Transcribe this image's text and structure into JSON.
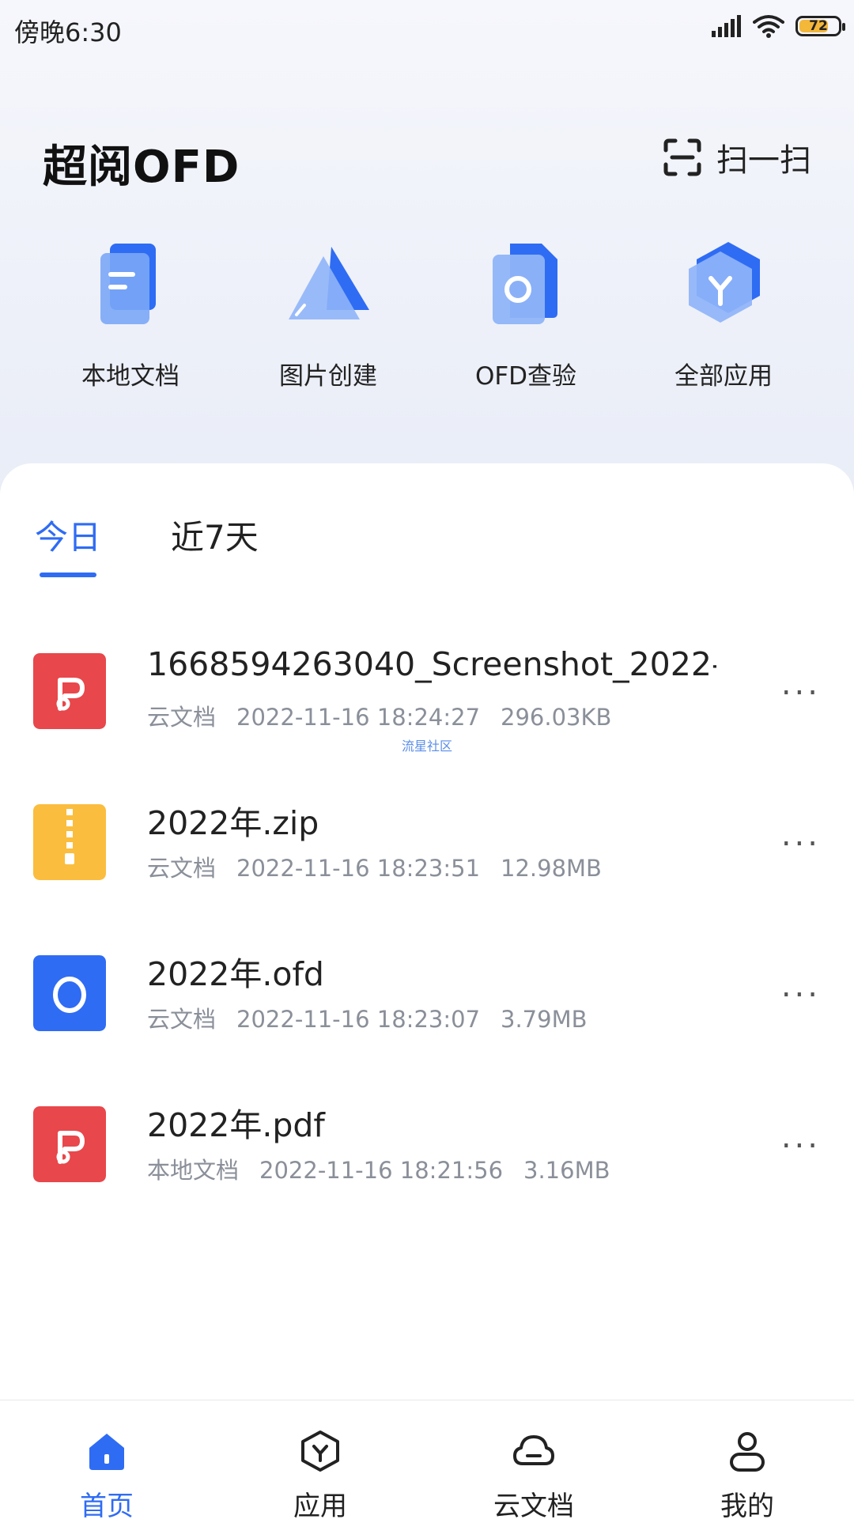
{
  "status_bar": {
    "time": "傍晚6:30",
    "battery": "72"
  },
  "header": {
    "title": "超阅OFD",
    "scan_label": "扫一扫"
  },
  "quick_actions": [
    {
      "label": "本地文档",
      "icon": "local-docs-icon"
    },
    {
      "label": "图片创建",
      "icon": "image-create-icon"
    },
    {
      "label": "OFD查验",
      "icon": "ofd-verify-icon"
    },
    {
      "label": "全部应用",
      "icon": "all-apps-icon"
    }
  ],
  "tabs": {
    "today": "今日",
    "last7": "近7天",
    "active": "today"
  },
  "files": [
    {
      "name": "1668594263040_Screenshot_2022-…",
      "source": "云文档",
      "time": "2022-11-16 18:24:27",
      "size": "296.03KB",
      "type": "pdf",
      "color": "#e8474b"
    },
    {
      "name": "2022年.zip",
      "source": "云文档",
      "time": "2022-11-16 18:23:51",
      "size": "12.98MB",
      "type": "zip",
      "color": "#fbbd3e"
    },
    {
      "name": "2022年.ofd",
      "source": "云文档",
      "time": "2022-11-16 18:23:07",
      "size": "3.79MB",
      "type": "ofd",
      "color": "#2f6cf4"
    },
    {
      "name": "2022年.pdf",
      "source": "本地文档",
      "time": "2022-11-16 18:21:56",
      "size": "3.16MB",
      "type": "pdf",
      "color": "#e8474b"
    }
  ],
  "more_label": "...",
  "watermark": "流星社区",
  "bottom_nav": [
    {
      "label": "首页",
      "icon": "home-icon",
      "active": true
    },
    {
      "label": "应用",
      "icon": "apps-icon",
      "active": false
    },
    {
      "label": "云文档",
      "icon": "cloud-icon",
      "active": false
    },
    {
      "label": "我的",
      "icon": "profile-icon",
      "active": false
    }
  ],
  "colors": {
    "accent": "#2f6cf4",
    "pdf": "#e8474b",
    "zip": "#fbbd3e",
    "ofd": "#2f6cf4"
  }
}
